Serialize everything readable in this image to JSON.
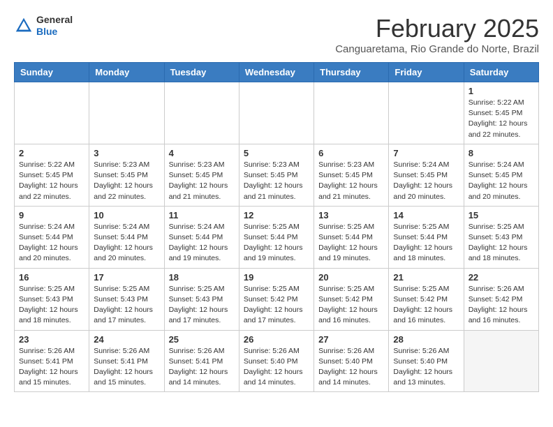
{
  "header": {
    "logo_general": "General",
    "logo_blue": "Blue",
    "month_title": "February 2025",
    "subtitle": "Canguaretama, Rio Grande do Norte, Brazil"
  },
  "weekdays": [
    "Sunday",
    "Monday",
    "Tuesday",
    "Wednesday",
    "Thursday",
    "Friday",
    "Saturday"
  ],
  "weeks": [
    [
      {
        "day": "",
        "info": ""
      },
      {
        "day": "",
        "info": ""
      },
      {
        "day": "",
        "info": ""
      },
      {
        "day": "",
        "info": ""
      },
      {
        "day": "",
        "info": ""
      },
      {
        "day": "",
        "info": ""
      },
      {
        "day": "1",
        "info": "Sunrise: 5:22 AM\nSunset: 5:45 PM\nDaylight: 12 hours\nand 22 minutes."
      }
    ],
    [
      {
        "day": "2",
        "info": "Sunrise: 5:22 AM\nSunset: 5:45 PM\nDaylight: 12 hours\nand 22 minutes."
      },
      {
        "day": "3",
        "info": "Sunrise: 5:23 AM\nSunset: 5:45 PM\nDaylight: 12 hours\nand 22 minutes."
      },
      {
        "day": "4",
        "info": "Sunrise: 5:23 AM\nSunset: 5:45 PM\nDaylight: 12 hours\nand 21 minutes."
      },
      {
        "day": "5",
        "info": "Sunrise: 5:23 AM\nSunset: 5:45 PM\nDaylight: 12 hours\nand 21 minutes."
      },
      {
        "day": "6",
        "info": "Sunrise: 5:23 AM\nSunset: 5:45 PM\nDaylight: 12 hours\nand 21 minutes."
      },
      {
        "day": "7",
        "info": "Sunrise: 5:24 AM\nSunset: 5:45 PM\nDaylight: 12 hours\nand 20 minutes."
      },
      {
        "day": "8",
        "info": "Sunrise: 5:24 AM\nSunset: 5:45 PM\nDaylight: 12 hours\nand 20 minutes."
      }
    ],
    [
      {
        "day": "9",
        "info": "Sunrise: 5:24 AM\nSunset: 5:44 PM\nDaylight: 12 hours\nand 20 minutes."
      },
      {
        "day": "10",
        "info": "Sunrise: 5:24 AM\nSunset: 5:44 PM\nDaylight: 12 hours\nand 20 minutes."
      },
      {
        "day": "11",
        "info": "Sunrise: 5:24 AM\nSunset: 5:44 PM\nDaylight: 12 hours\nand 19 minutes."
      },
      {
        "day": "12",
        "info": "Sunrise: 5:25 AM\nSunset: 5:44 PM\nDaylight: 12 hours\nand 19 minutes."
      },
      {
        "day": "13",
        "info": "Sunrise: 5:25 AM\nSunset: 5:44 PM\nDaylight: 12 hours\nand 19 minutes."
      },
      {
        "day": "14",
        "info": "Sunrise: 5:25 AM\nSunset: 5:44 PM\nDaylight: 12 hours\nand 18 minutes."
      },
      {
        "day": "15",
        "info": "Sunrise: 5:25 AM\nSunset: 5:43 PM\nDaylight: 12 hours\nand 18 minutes."
      }
    ],
    [
      {
        "day": "16",
        "info": "Sunrise: 5:25 AM\nSunset: 5:43 PM\nDaylight: 12 hours\nand 18 minutes."
      },
      {
        "day": "17",
        "info": "Sunrise: 5:25 AM\nSunset: 5:43 PM\nDaylight: 12 hours\nand 17 minutes."
      },
      {
        "day": "18",
        "info": "Sunrise: 5:25 AM\nSunset: 5:43 PM\nDaylight: 12 hours\nand 17 minutes."
      },
      {
        "day": "19",
        "info": "Sunrise: 5:25 AM\nSunset: 5:42 PM\nDaylight: 12 hours\nand 17 minutes."
      },
      {
        "day": "20",
        "info": "Sunrise: 5:25 AM\nSunset: 5:42 PM\nDaylight: 12 hours\nand 16 minutes."
      },
      {
        "day": "21",
        "info": "Sunrise: 5:25 AM\nSunset: 5:42 PM\nDaylight: 12 hours\nand 16 minutes."
      },
      {
        "day": "22",
        "info": "Sunrise: 5:26 AM\nSunset: 5:42 PM\nDaylight: 12 hours\nand 16 minutes."
      }
    ],
    [
      {
        "day": "23",
        "info": "Sunrise: 5:26 AM\nSunset: 5:41 PM\nDaylight: 12 hours\nand 15 minutes."
      },
      {
        "day": "24",
        "info": "Sunrise: 5:26 AM\nSunset: 5:41 PM\nDaylight: 12 hours\nand 15 minutes."
      },
      {
        "day": "25",
        "info": "Sunrise: 5:26 AM\nSunset: 5:41 PM\nDaylight: 12 hours\nand 14 minutes."
      },
      {
        "day": "26",
        "info": "Sunrise: 5:26 AM\nSunset: 5:40 PM\nDaylight: 12 hours\nand 14 minutes."
      },
      {
        "day": "27",
        "info": "Sunrise: 5:26 AM\nSunset: 5:40 PM\nDaylight: 12 hours\nand 14 minutes."
      },
      {
        "day": "28",
        "info": "Sunrise: 5:26 AM\nSunset: 5:40 PM\nDaylight: 12 hours\nand 13 minutes."
      },
      {
        "day": "",
        "info": ""
      }
    ]
  ]
}
